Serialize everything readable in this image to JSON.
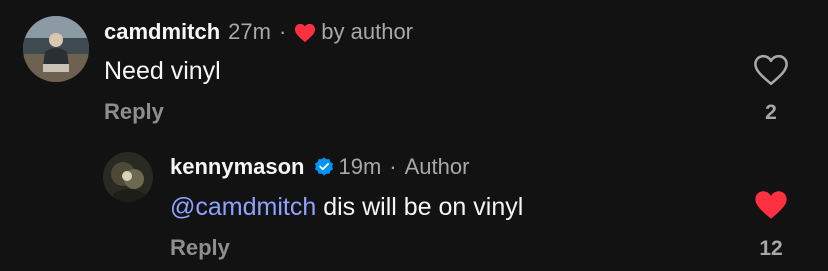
{
  "colors": {
    "background": "#121212",
    "text": "#f5f5f5",
    "muted": "#a8a8a8",
    "mention": "#8ea2ff",
    "heart": "#ff3040",
    "verified": "#0095f6"
  },
  "comments": [
    {
      "username": "camdmitch",
      "time": "27m",
      "separator": "·",
      "liked_by_label": "by author",
      "liked_icon": "heart-icon",
      "text": "Need vinyl",
      "reply_label": "Reply",
      "like_icon": "heart-outline-icon",
      "liked": false,
      "like_count": "2"
    },
    {
      "username": "kennymason",
      "verified_icon": "verified-badge-icon",
      "time": "19m",
      "separator": "·",
      "author_label": "Author",
      "mention": "@camdmitch",
      "text": " dis will be on vinyl",
      "reply_label": "Reply",
      "like_icon": "heart-filled-icon",
      "liked": true,
      "like_count": "12"
    }
  ]
}
